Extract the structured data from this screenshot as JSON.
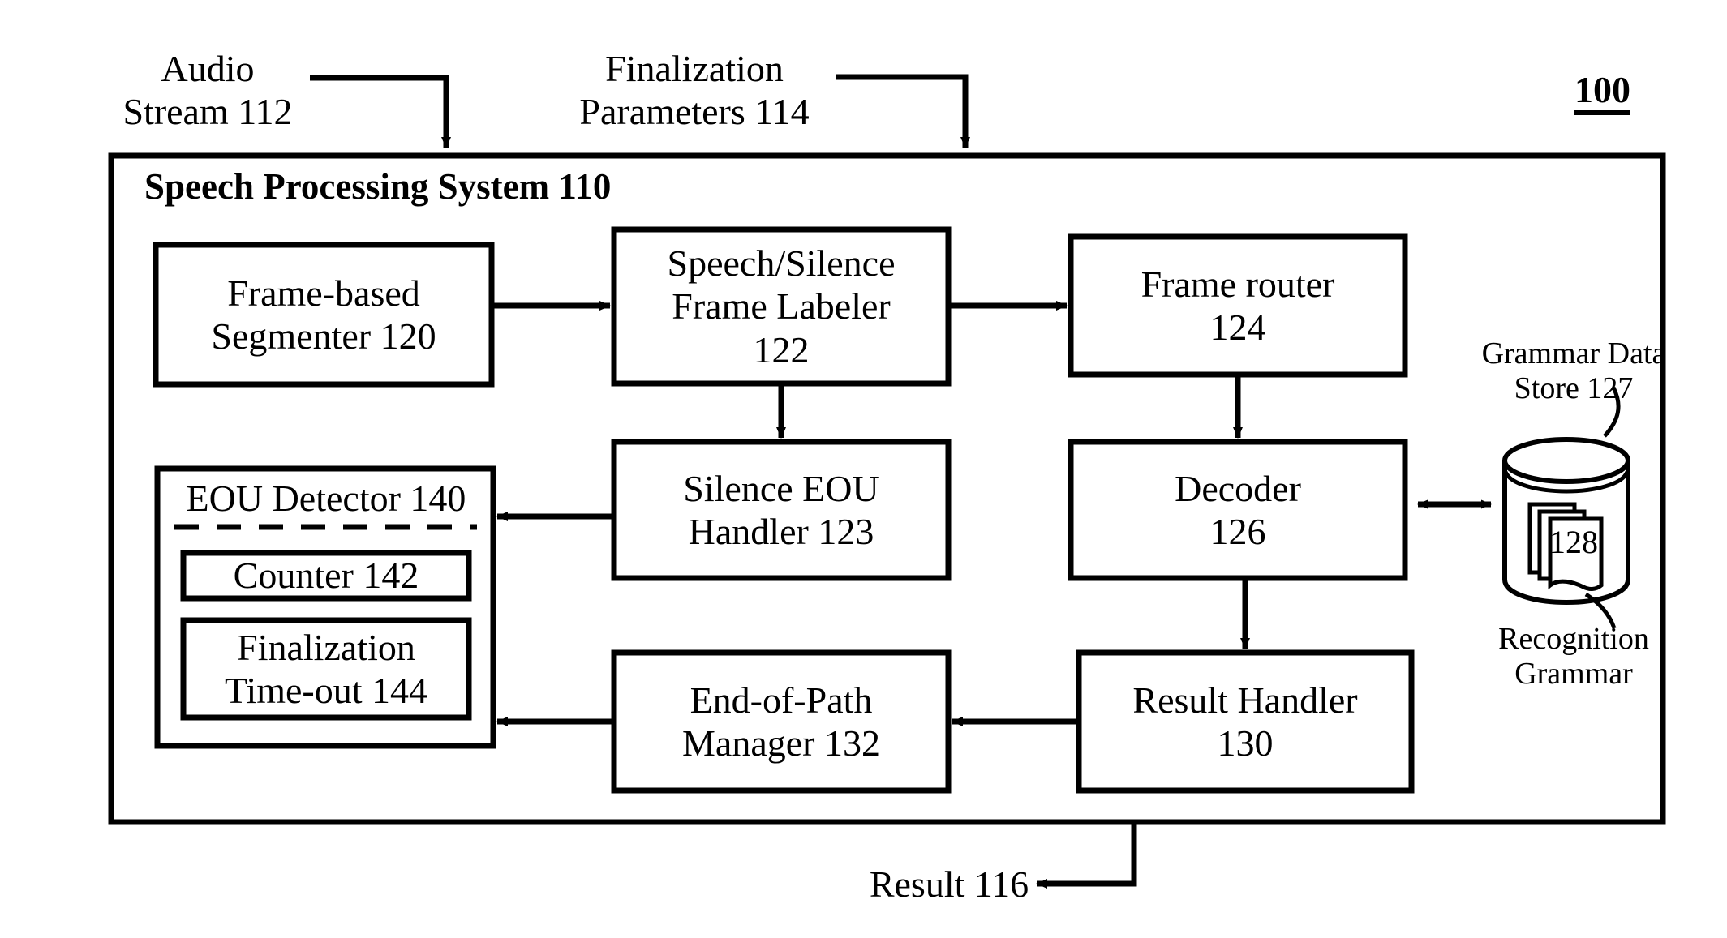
{
  "figure": {
    "number": "100",
    "system_title": "Speech Processing System 110"
  },
  "inputs": [
    {
      "id": "audio-stream",
      "label": "Audio\nStream 112"
    },
    {
      "id": "finalization-parameters",
      "label": "Finalization\nParameters 114"
    }
  ],
  "outputs": [
    {
      "id": "result",
      "label": "Result 116"
    }
  ],
  "blocks": {
    "segmenter": {
      "label": "Frame-based\nSegmenter 120"
    },
    "frame_labeler": {
      "label": "Speech/Silence\nFrame Labeler\n122"
    },
    "frame_router": {
      "label": "Frame router\n124"
    },
    "silence_eou_handler": {
      "label": "Silence EOU\nHandler 123"
    },
    "decoder": {
      "label": "Decoder\n126"
    },
    "eou_detector": {
      "label": "EOU Detector 140"
    },
    "counter": {
      "label": "Counter 142"
    },
    "finalization_timeout": {
      "label": "Finalization\nTime-out 144"
    },
    "end_of_path_manager": {
      "label": "End-of-Path\nManager 132"
    },
    "result_handler": {
      "label": "Result Handler\n130"
    }
  },
  "datastore": {
    "title": "Grammar Data\nStore 127",
    "item_number": "128",
    "caption": "Recognition\nGrammar"
  },
  "icons": {
    "database": "database-cylinder-icon",
    "documents": "stacked-documents-icon",
    "arrow": "arrow-icon",
    "bidirectional_arrow": "bidirectional-arrow-icon"
  },
  "style": {
    "line_color": "#000000",
    "background": "#ffffff"
  }
}
